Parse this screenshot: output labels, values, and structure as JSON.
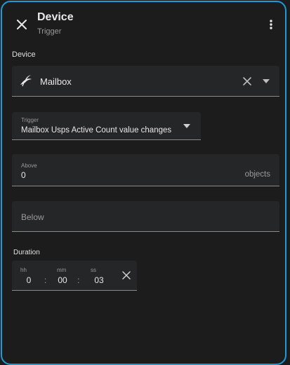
{
  "header": {
    "title": "Device",
    "subtitle": "Trigger",
    "close_icon": "close-icon",
    "more_icon": "more-vertical-icon"
  },
  "device_section": {
    "label": "Device",
    "selected_device": "Mailbox",
    "device_icon": "bird-icon"
  },
  "trigger": {
    "label": "Trigger",
    "value": "Mailbox Usps Active Count value changes"
  },
  "above": {
    "label": "Above",
    "value": "0",
    "suffix": "objects"
  },
  "below": {
    "placeholder": "Below"
  },
  "duration": {
    "label": "Duration",
    "hh_label": "hh",
    "mm_label": "mm",
    "ss_label": "ss",
    "hh_value": "0",
    "mm_value": "00",
    "ss_value": "03",
    "separator": ":"
  },
  "colors": {
    "accent_border": "#1d9bd6",
    "surface": "#1c1c1c",
    "field_bg": "#252628"
  }
}
